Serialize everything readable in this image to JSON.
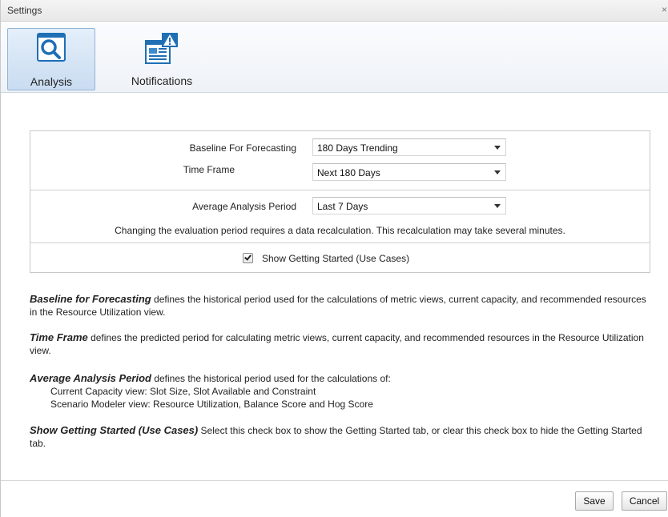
{
  "window": {
    "title": "Settings",
    "close_glyph": "×"
  },
  "toolbar": {
    "tabs": [
      {
        "label": "Analysis",
        "icon": "magnifier-icon",
        "selected": true
      },
      {
        "label": "Notifications",
        "icon": "notification-alert-icon",
        "selected": false
      }
    ]
  },
  "settings": {
    "baseline": {
      "label": "Baseline For Forecasting",
      "value": "180 Days Trending"
    },
    "time_frame": {
      "label": "Time Frame",
      "value": "Next 180 Days"
    },
    "average_period": {
      "label": "Average Analysis Period",
      "value": "Last 7 Days"
    },
    "recalc_note": "Changing the evaluation period requires a data recalculation. This recalculation may take several minutes.",
    "show_getting_started": {
      "label": "Show Getting Started (Use Cases)",
      "checked": true
    }
  },
  "help": {
    "baseline": {
      "term": "Baseline for Forecasting",
      "text": " defines the historical period used for the calculations of metric views, current capacity, and recommended resources in the Resource Utilization view."
    },
    "time_frame": {
      "term": "Time Frame",
      "text": " defines the predicted period for calculating metric views, current capacity, and recommended resources in the Resource Utilization view."
    },
    "average_period": {
      "term": "Average Analysis Period",
      "text": " defines the historical period used for the calculations of:",
      "line1": "Current Capacity view: Slot Size, Slot Available and Constraint",
      "line2": "Scenario Modeler view: Resource Utilization, Balance Score and Hog Score"
    },
    "show_getting_started": {
      "term": "Show Getting Started (Use Cases)",
      "text": " Select this check box to show the Getting Started tab, or clear this check box to hide the Getting Started tab."
    }
  },
  "buttons": {
    "save": "Save",
    "cancel": "Cancel"
  },
  "colors": {
    "selected_tab": "#c9dcf1",
    "icon_blue": "#1f6fb5"
  }
}
